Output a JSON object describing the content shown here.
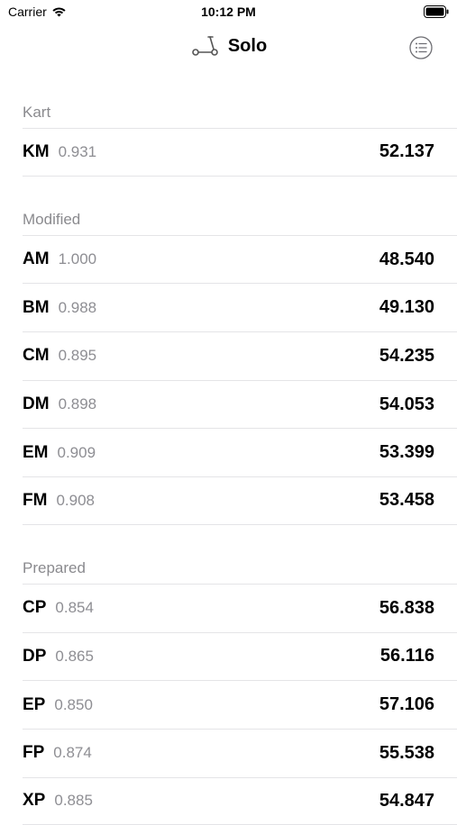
{
  "status_bar": {
    "carrier": "Carrier",
    "time": "10:12 PM"
  },
  "nav": {
    "title": "Solo",
    "title_icon": "scooter-icon",
    "menu_icon": "list-icon"
  },
  "sections": [
    {
      "header": "Kart",
      "rows": [
        {
          "code": "KM",
          "factor": "0.931",
          "time": "52.137"
        }
      ]
    },
    {
      "header": "Modified",
      "rows": [
        {
          "code": "AM",
          "factor": "1.000",
          "time": "48.540"
        },
        {
          "code": "BM",
          "factor": "0.988",
          "time": "49.130"
        },
        {
          "code": "CM",
          "factor": "0.895",
          "time": "54.235"
        },
        {
          "code": "DM",
          "factor": "0.898",
          "time": "54.053"
        },
        {
          "code": "EM",
          "factor": "0.909",
          "time": "53.399"
        },
        {
          "code": "FM",
          "factor": "0.908",
          "time": "53.458"
        }
      ]
    },
    {
      "header": "Prepared",
      "rows": [
        {
          "code": "CP",
          "factor": "0.854",
          "time": "56.838"
        },
        {
          "code": "DP",
          "factor": "0.865",
          "time": "56.116"
        },
        {
          "code": "EP",
          "factor": "0.850",
          "time": "57.106"
        },
        {
          "code": "FP",
          "factor": "0.874",
          "time": "55.538"
        },
        {
          "code": "XP",
          "factor": "0.885",
          "time": "54.847"
        }
      ]
    }
  ],
  "colors": {
    "secondary_text": "#8e8e93",
    "separator": "#e4e4e7"
  }
}
